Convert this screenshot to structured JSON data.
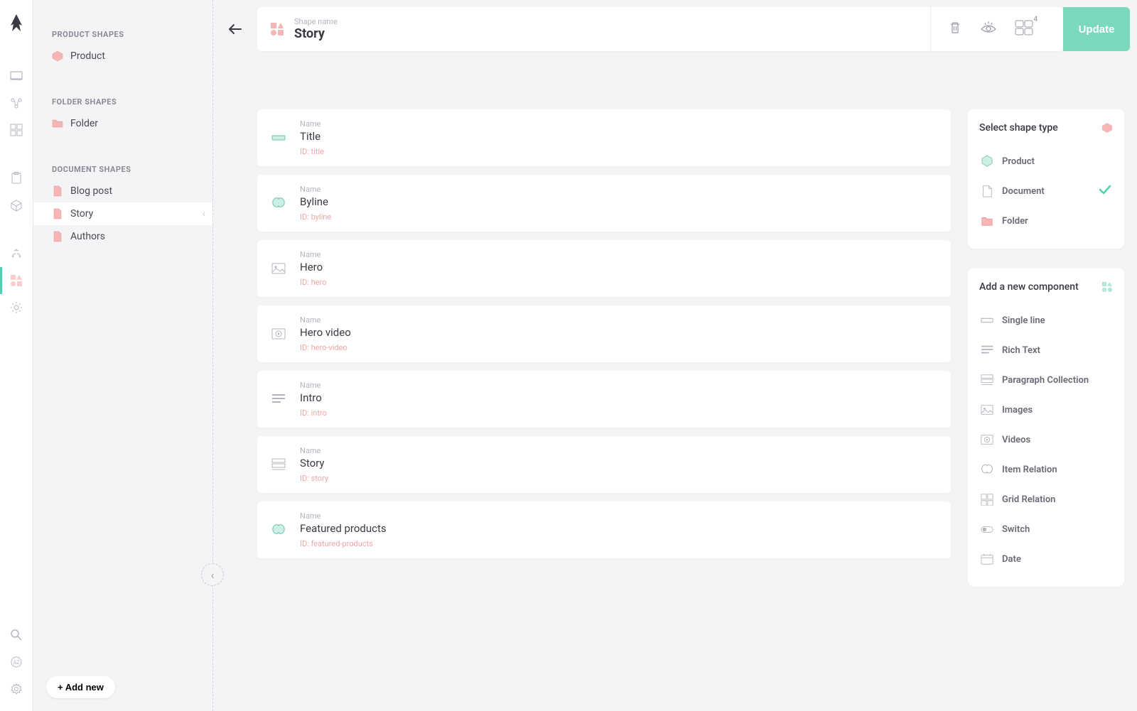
{
  "sidebar": {
    "sections": {
      "product": {
        "title": "PRODUCT SHAPES",
        "items": [
          {
            "label": "Product"
          }
        ]
      },
      "folder": {
        "title": "FOLDER SHAPES",
        "items": [
          {
            "label": "Folder"
          }
        ]
      },
      "document": {
        "title": "DOCUMENT SHAPES",
        "items": [
          {
            "label": "Blog post"
          },
          {
            "label": "Story"
          },
          {
            "label": "Authors"
          }
        ]
      }
    },
    "add_new_label": "+ Add new"
  },
  "header": {
    "eyebrow": "Shape name",
    "name": "Story",
    "translations_count": "4",
    "update_label": "Update"
  },
  "components": [
    {
      "eyebrow": "Name",
      "name": "Title",
      "id": "ID: title",
      "icon": "single-line"
    },
    {
      "eyebrow": "Name",
      "name": "Byline",
      "id": "ID: byline",
      "icon": "relation"
    },
    {
      "eyebrow": "Name",
      "name": "Hero",
      "id": "ID: hero",
      "icon": "images"
    },
    {
      "eyebrow": "Name",
      "name": "Hero video",
      "id": "ID: hero-video",
      "icon": "videos"
    },
    {
      "eyebrow": "Name",
      "name": "Intro",
      "id": "ID: intro",
      "icon": "rich-text"
    },
    {
      "eyebrow": "Name",
      "name": "Story",
      "id": "ID: story",
      "icon": "paragraph-collection"
    },
    {
      "eyebrow": "Name",
      "name": "Featured products",
      "id": "ID: featured-products",
      "icon": "relation"
    }
  ],
  "shape_type_panel": {
    "title": "Select shape type",
    "options": [
      {
        "label": "Product",
        "icon": "product"
      },
      {
        "label": "Document",
        "icon": "document",
        "selected": true
      },
      {
        "label": "Folder",
        "icon": "folder"
      }
    ]
  },
  "add_component_panel": {
    "title": "Add a new component",
    "options": [
      {
        "label": "Single line",
        "icon": "single-line"
      },
      {
        "label": "Rich Text",
        "icon": "rich-text"
      },
      {
        "label": "Paragraph Collection",
        "icon": "paragraph-collection"
      },
      {
        "label": "Images",
        "icon": "images"
      },
      {
        "label": "Videos",
        "icon": "videos"
      },
      {
        "label": "Item Relation",
        "icon": "relation"
      },
      {
        "label": "Grid Relation",
        "icon": "grid-relation"
      },
      {
        "label": "Switch",
        "icon": "switch"
      },
      {
        "label": "Date",
        "icon": "date"
      }
    ]
  }
}
